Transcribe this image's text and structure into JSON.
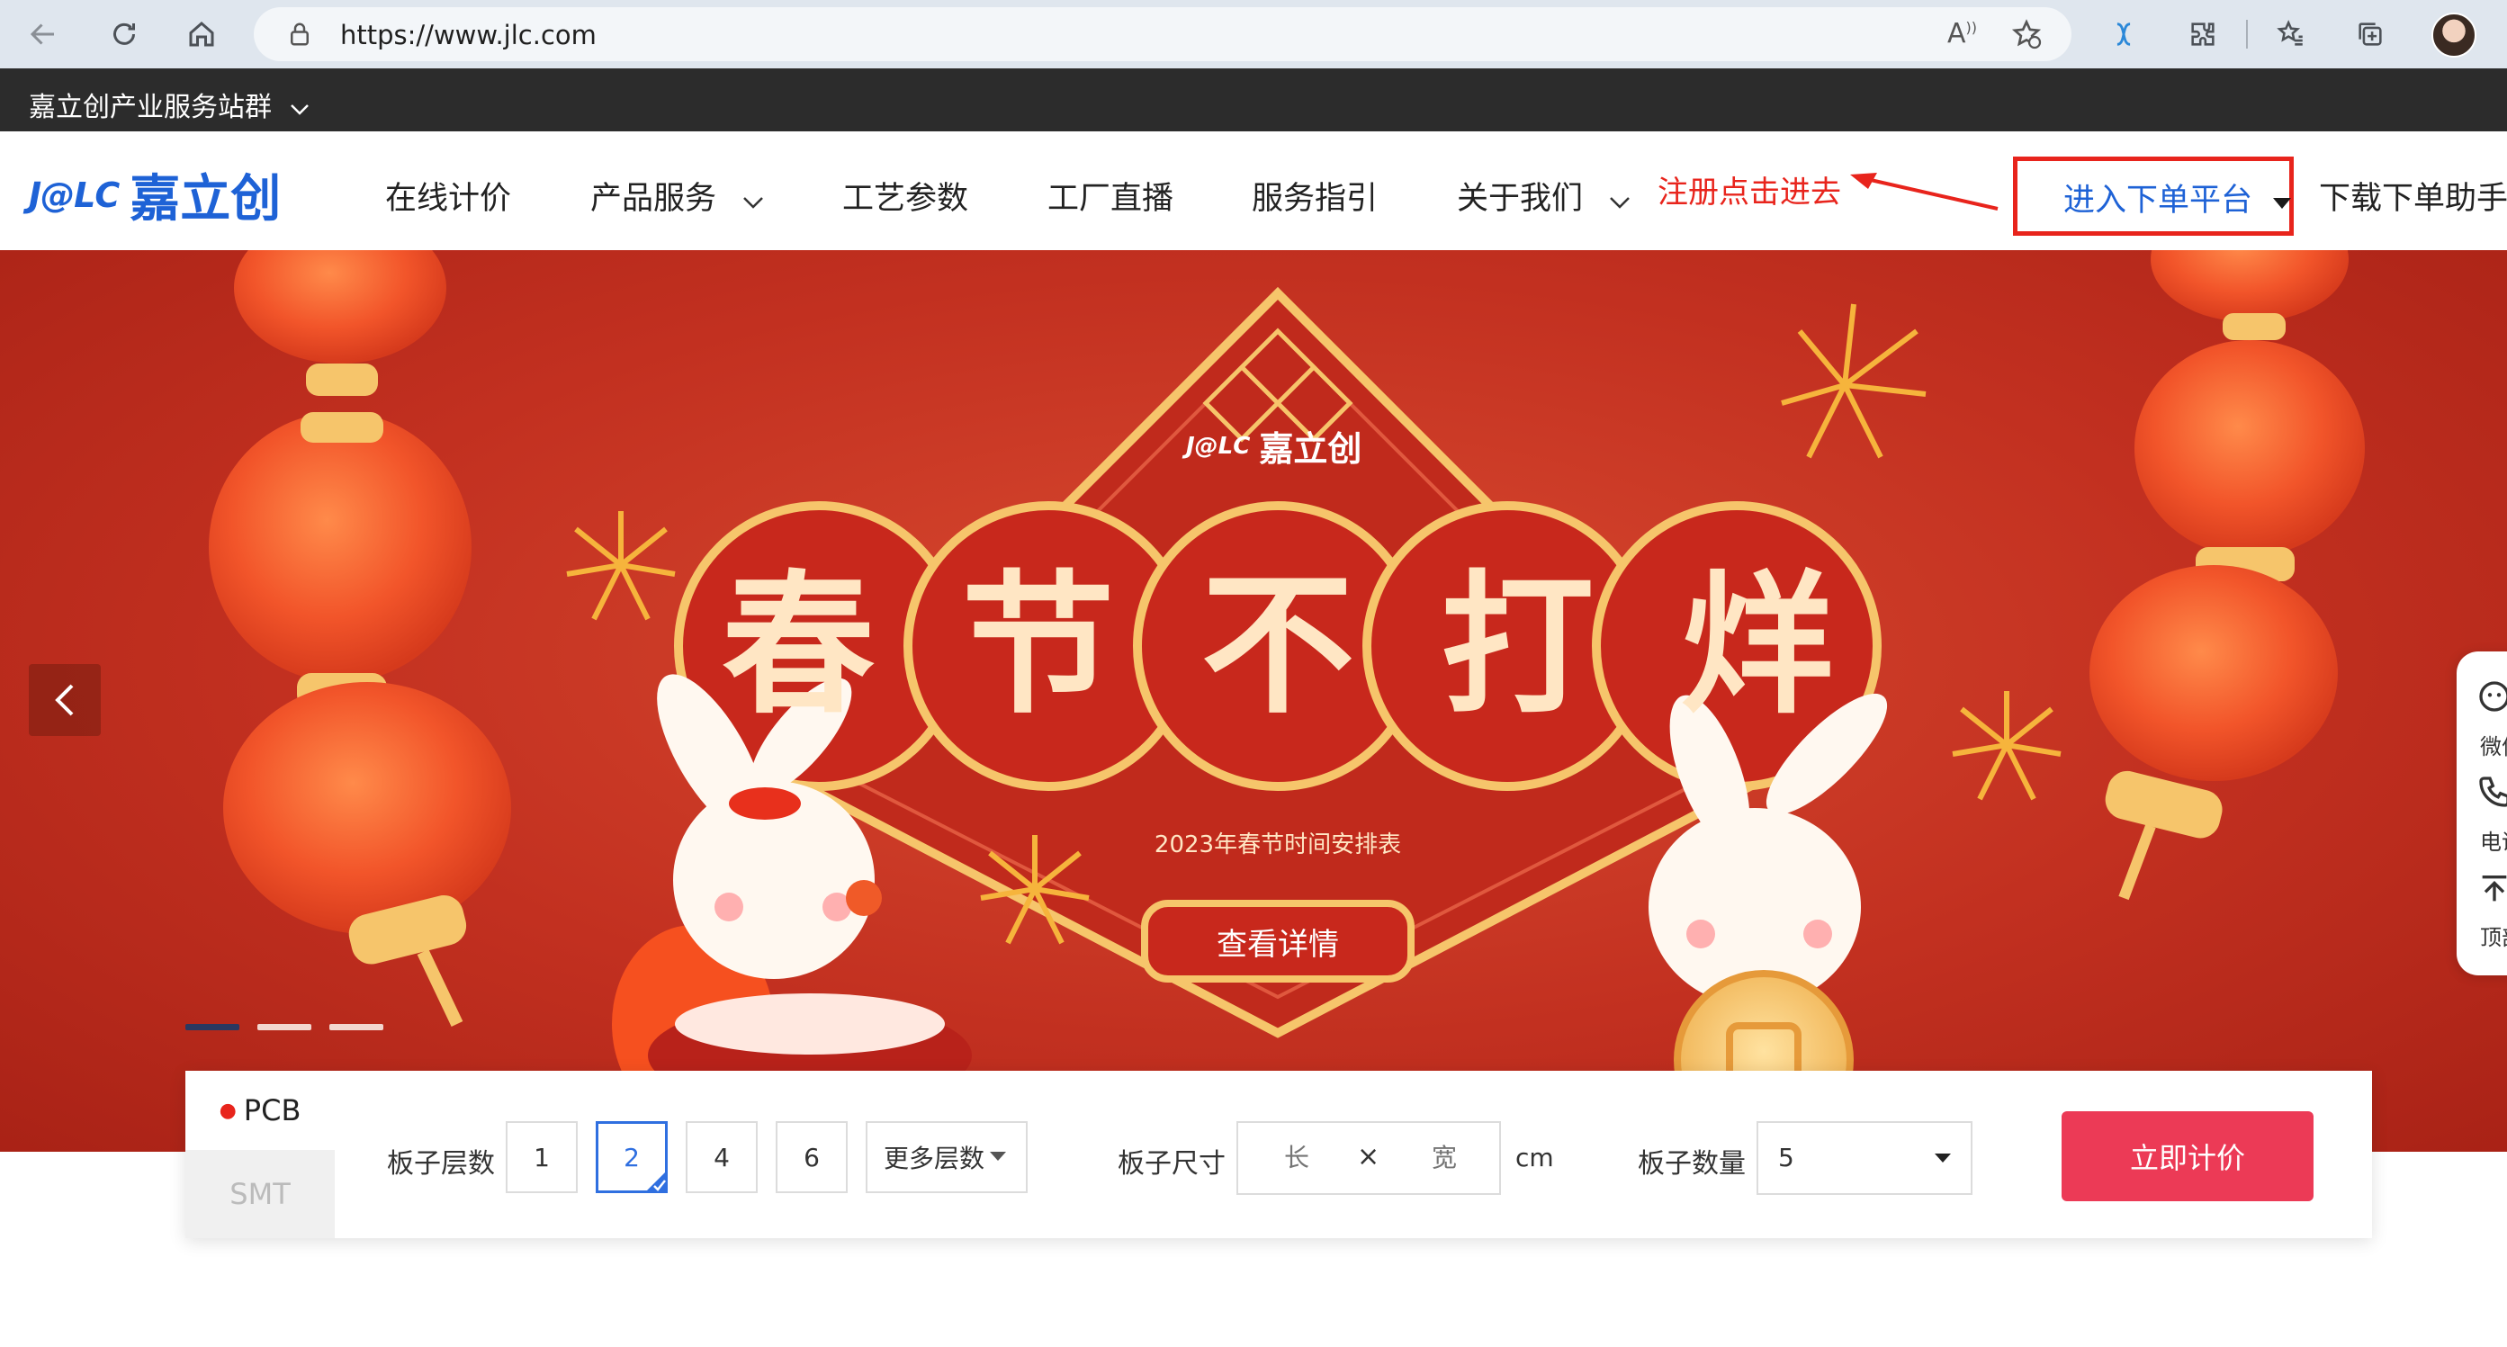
{
  "browser": {
    "url": "https://www.jlc.com",
    "read_aloud_label": "Â"
  },
  "station_bar": {
    "label": "嘉立创产业服务站群"
  },
  "header": {
    "logo_mark": "J@LC",
    "logo_text": "嘉立创",
    "nav": [
      {
        "label": "在线计价"
      },
      {
        "label": "产品服务"
      },
      {
        "label": "工艺参数"
      },
      {
        "label": "工厂直播"
      },
      {
        "label": "服务指引"
      },
      {
        "label": "关于我们"
      }
    ],
    "annotation": "注册点击进去",
    "order_platform": "进入下单平台",
    "download_helper": "下载下单助手"
  },
  "banner": {
    "brand_mark": "J@LC",
    "brand_text": "嘉立创",
    "headline_chars": [
      "春",
      "节",
      "不",
      "打",
      "烊"
    ],
    "subtitle": "2023年春节时间安排表",
    "cta": "查看详情",
    "slides_total": 3,
    "slide_active": 1
  },
  "quote_form": {
    "tabs": [
      {
        "label": "PCB",
        "active": true
      },
      {
        "label": "SMT",
        "active": false
      }
    ],
    "layers_label": "板子层数",
    "layer_options": [
      "1",
      "2",
      "4",
      "6"
    ],
    "layer_selected": "2",
    "more_layers": "更多层数",
    "size_label": "板子尺寸",
    "length_placeholder": "长",
    "times": "×",
    "width_placeholder": "宽",
    "size_unit": "cm",
    "qty_label": "板子数量",
    "qty_value": "5",
    "submit": "立即计价"
  },
  "float_panel": {
    "items": [
      "微信",
      "电话",
      "顶部"
    ]
  },
  "colors": {
    "accent_red": "#e8241c",
    "brand_blue": "#1e62d6",
    "quote_pink": "#ec3a56",
    "banner_red": "#c23020",
    "gold": "#f5c97a"
  }
}
